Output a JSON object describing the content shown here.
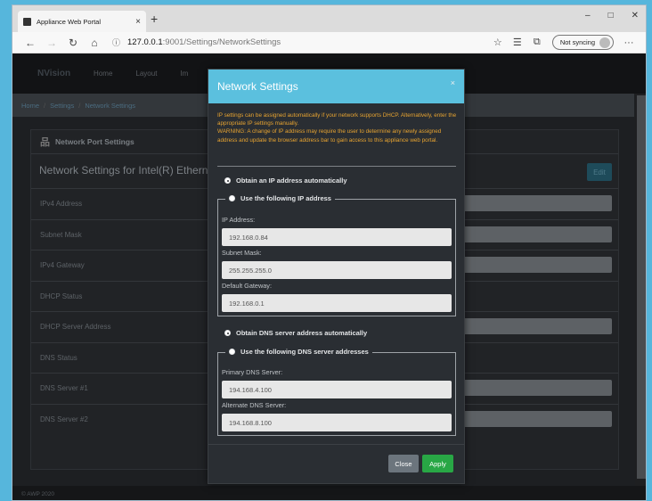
{
  "browser": {
    "tab_title": "Appliance Web Portal",
    "tab_close": "×",
    "new_tab": "+",
    "win_minimize": "–",
    "win_maximize": "□",
    "win_close": "✕",
    "url_host": "127.0.0.1",
    "url_path": ":9001/Settings/NetworkSettings",
    "sync_label": "Not syncing",
    "more": "···"
  },
  "app": {
    "brand": "NVision",
    "nav": [
      "Home",
      "Layout",
      "Im"
    ],
    "breadcrumb": [
      "Home",
      "Settings",
      "Network Settings"
    ],
    "card_header": "Network Port Settings",
    "card_title": "Network Settings for Intel(R) Etherne",
    "edit_label": "Edit",
    "rows": [
      "IPv4 Address",
      "Subnet Mask",
      "IPv4 Gateway",
      "DHCP Status",
      "DHCP Server Address",
      "DNS Status",
      "DNS Server #1",
      "DNS Server #2"
    ],
    "footer": "© AWP 2020"
  },
  "modal": {
    "title": "Network Settings",
    "close_x": "×",
    "info_line1": "IP settings can be assigned automatically if your network supports DHCP. Alternatively, enter the appropriate IP settings manually.",
    "info_line2": "WARNING: A change of IP address may require the user to determine any newly assigned address and update the browser address bar to gain access to this appliance web portal.",
    "ip_auto_label": "Obtain an IP address automatically",
    "ip_manual_label": "Use the following IP address",
    "ip_address_label": "IP Address:",
    "ip_address_value": "192.168.0.84",
    "subnet_label": "Subnet Mask:",
    "subnet_value": "255.255.255.0",
    "gateway_label": "Default Gateway:",
    "gateway_value": "192.168.0.1",
    "dns_auto_label": "Obtain DNS server address automatically",
    "dns_manual_label": "Use the following DNS server addresses",
    "primary_dns_label": "Primary DNS Server:",
    "primary_dns_value": "194.168.4.100",
    "alternate_dns_label": "Alternate DNS Server:",
    "alternate_dns_value": "194.168.8.100",
    "close_button": "Close",
    "apply_button": "Apply"
  },
  "colors": {
    "modal_header": "#5bc0de",
    "warning_text": "#e8a431",
    "apply_button": "#28a745",
    "close_button": "#6c757d"
  }
}
